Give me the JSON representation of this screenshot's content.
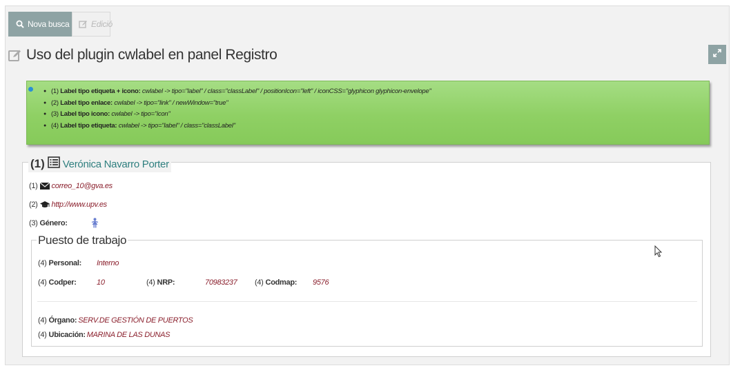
{
  "toolbar": {
    "search_label": "Nova busca",
    "edit_label": "Edició"
  },
  "page": {
    "title": "Uso del plugin cwlabel en panel Registro"
  },
  "info": {
    "items": [
      {
        "prefix": "(1) ",
        "bold": "Label tipo etiqueta + icono:",
        "italic": " cwlabel -> tipo=\"label\" / class=\"classLabel\" / positionIcon=\"left\" / iconCSS=\"glyphicon glyphicon-envelope\""
      },
      {
        "prefix": "(2) ",
        "bold": "Label tipo enlace:",
        "italic": " cwlabel -> tipo=\"link\" / newWindow=\"true\""
      },
      {
        "prefix": "(3) ",
        "bold": "Label tipo icono:",
        "italic": " cwlabel -> tipo=\"icon\""
      },
      {
        "prefix": "(4) ",
        "bold": "Label tipo etiqueta:",
        "italic": " cwlabel -> tipo=\"label\" / class=\"classLabel\""
      }
    ]
  },
  "record": {
    "legend_num": "(1)",
    "name": "Verónica Navarro Porter",
    "email_prefix": "(1)",
    "email": "correo_10@gva.es",
    "web_prefix": "(2)",
    "web": "http://www.upv.es",
    "gender_prefix": "(3)",
    "gender_label": "Género:"
  },
  "job": {
    "legend": "Puesto de trabajo",
    "personal_prefix": "(4)",
    "personal_label": "Personal:",
    "personal_value": "Interno",
    "codper_prefix": "(4)",
    "codper_label": "Codper:",
    "codper_value": "10",
    "nrp_prefix": "(4)",
    "nrp_label": "NRP:",
    "nrp_value": "70983237",
    "codmap_prefix": "(4)",
    "codmap_label": "Codmap:",
    "codmap_value": "9576",
    "organo_prefix": "(4)",
    "organo_label": "Órgano:",
    "organo_value": "SERV.DE GESTIÓN DE PUERTOS",
    "ubicacion_prefix": "(4)",
    "ubicacion_label": "Ubicación:",
    "ubicacion_value": "MARINA DE LAS DUNAS"
  },
  "icons": {
    "search": "search-icon",
    "edit": "edit-icon",
    "expand": "expand-icon",
    "list": "list-icon",
    "envelope": "envelope-icon",
    "graduation": "graduation-cap-icon",
    "female": "female-icon",
    "info": "info-icon"
  },
  "colors": {
    "button": "#8ea3a4",
    "info_bg": "#8fd064",
    "link": "#8a1f2c",
    "name": "#2f7f7f",
    "female_icon": "#6a7fd0"
  }
}
